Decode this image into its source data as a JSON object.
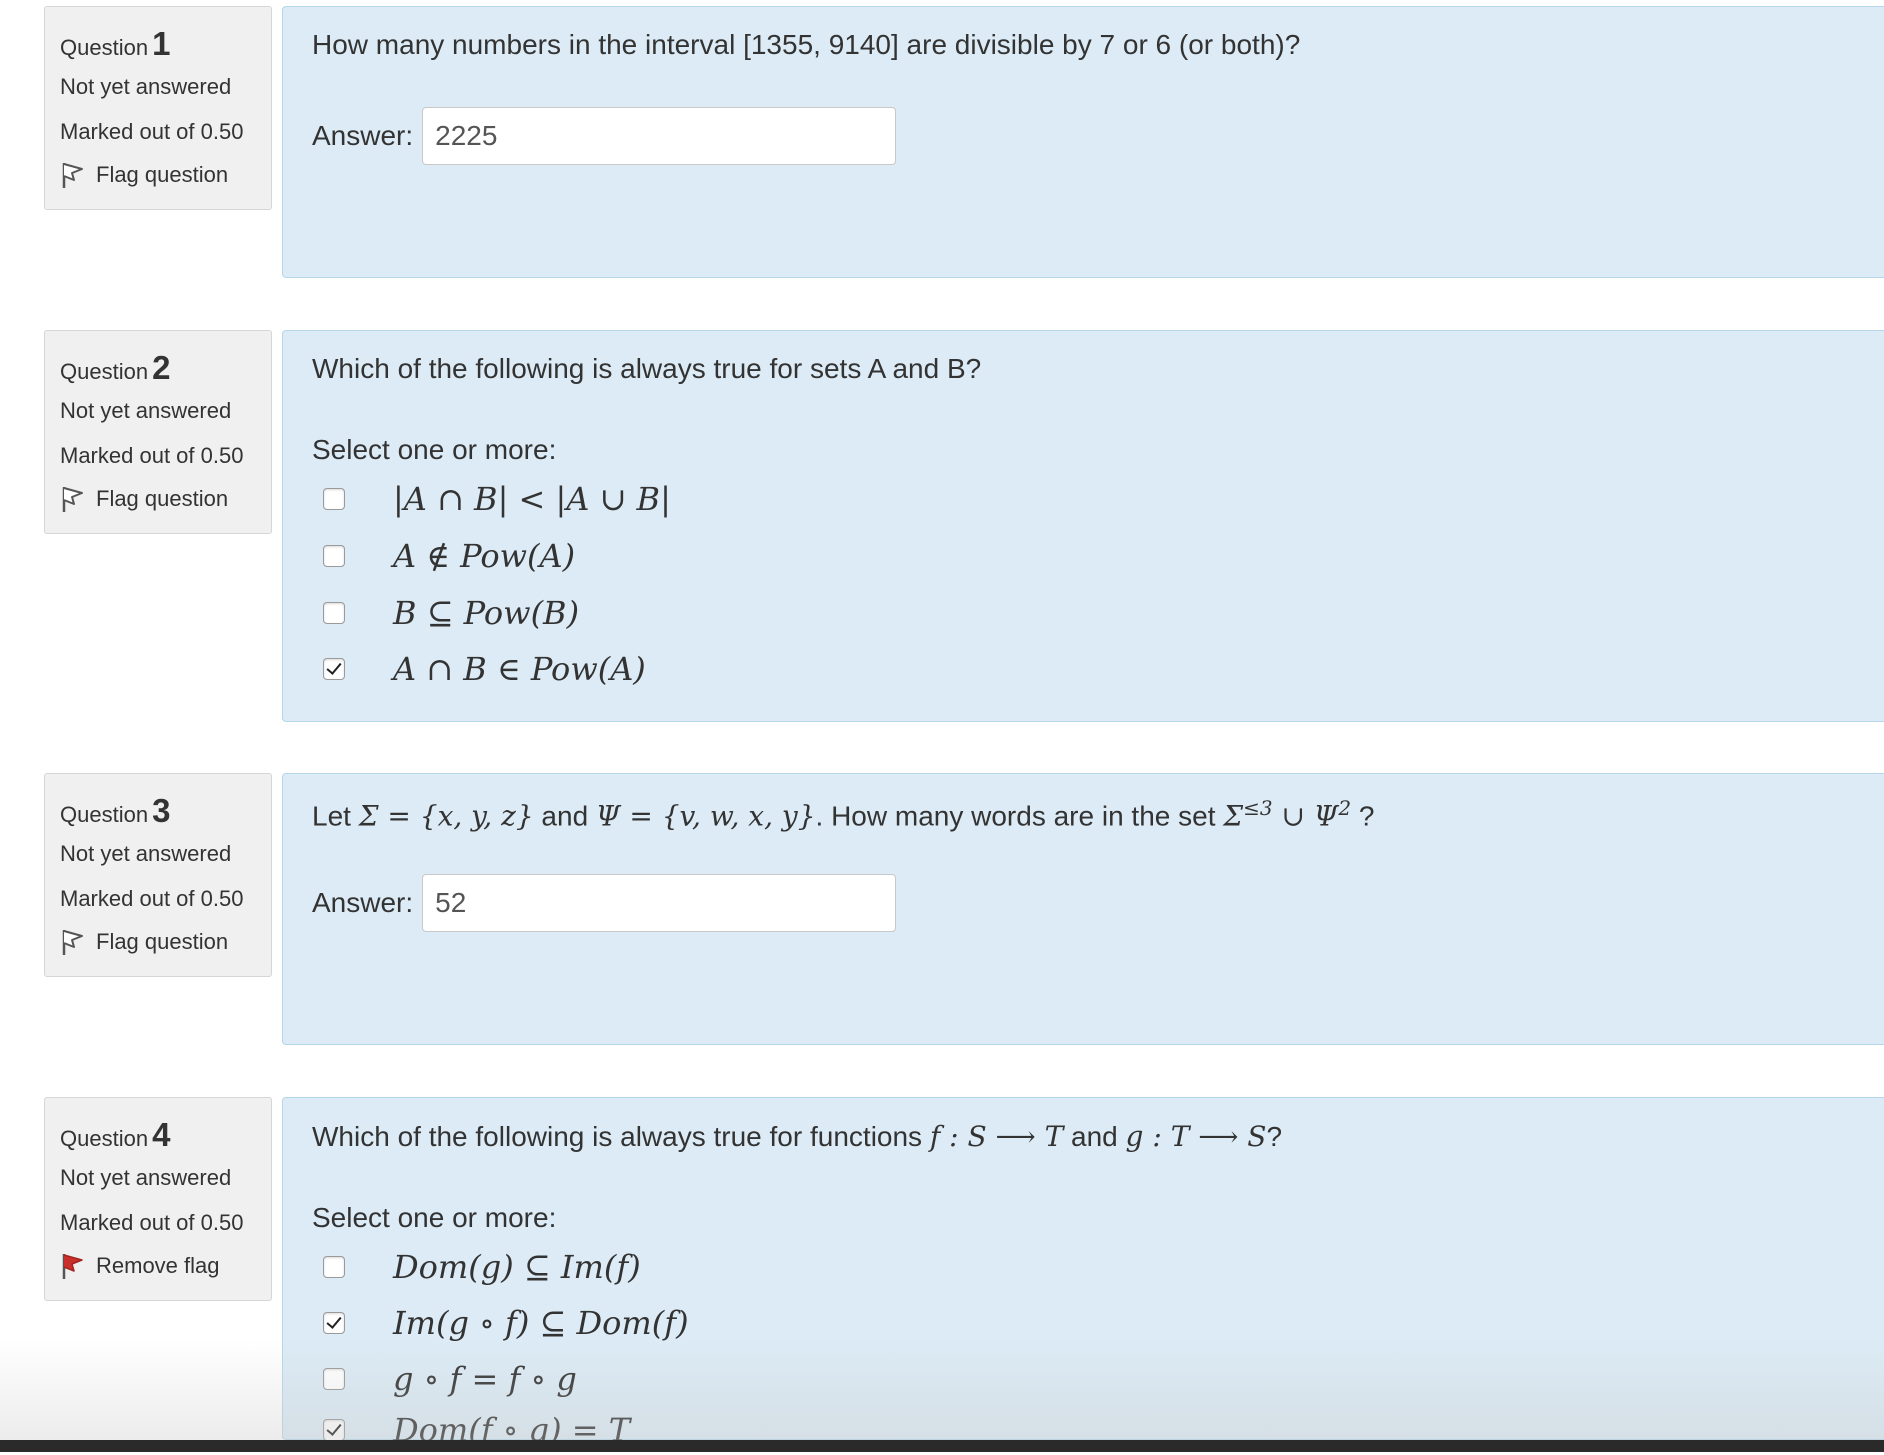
{
  "questions": [
    {
      "label": "Question",
      "number": "1",
      "state": "Not yet answered",
      "grade": "Marked out of 0.50",
      "flag_label": "Flag question",
      "flag_icon": "flag-outline-icon",
      "text": "How many numbers in the interval [1355, 9140] are divisible by 7 or 6 (or both)?",
      "answer_label": "Answer:",
      "answer_value": "2225"
    },
    {
      "label": "Question",
      "number": "2",
      "state": "Not yet answered",
      "grade": "Marked out of 0.50",
      "flag_label": "Flag question",
      "flag_icon": "flag-outline-icon",
      "text": "Which of the following is always true for sets A and B?",
      "prompt": "Select one or more:",
      "options": [
        {
          "text": "|A ∩ B| < |A ∪ B|",
          "checked": false
        },
        {
          "text": "A ∉ Pow(A)",
          "checked": false
        },
        {
          "text": "B ⊆ Pow(B)",
          "checked": false
        },
        {
          "text": "A ∩ B ∈ Pow(A)",
          "checked": true
        }
      ]
    },
    {
      "label": "Question",
      "number": "3",
      "state": "Not yet answered",
      "grade": "Marked out of 0.50",
      "flag_label": "Flag question",
      "flag_icon": "flag-outline-icon",
      "text_parts": {
        "let": "Let ",
        "sigma_def": "Σ = {x, y, z}",
        "and": " and ",
        "psi_def": "Ψ = {v, w, x, y}",
        "rest": ". How many words are in the set ",
        "set_expr": "Σ",
        "sup1": "≤3",
        "union": " ∪ Ψ",
        "sup2": "2",
        "end": " ?"
      },
      "answer_label": "Answer:",
      "answer_value": "52"
    },
    {
      "label": "Question",
      "number": "4",
      "state": "Not yet answered",
      "grade": "Marked out of 0.50",
      "flag_label": "Remove flag",
      "flag_icon": "flag-filled-red-icon",
      "text_parts": {
        "lead": "Which of the following is always true for functions ",
        "f_expr": "f : S ⟶ T",
        "and": " and ",
        "g_expr": "g : T ⟶ S",
        "end": "?"
      },
      "prompt": "Select one or more:",
      "options": [
        {
          "text": "Dom(g) ⊆ Im(f)",
          "checked": false
        },
        {
          "text": "Im(g ∘ f) ⊆ Dom(f)",
          "checked": true
        },
        {
          "text": "g ∘ f = f ∘ g",
          "checked": false
        },
        {
          "text": "Dom(f ∘ g) = T",
          "checked": true
        }
      ]
    }
  ],
  "colors": {
    "info_bg": "#f0f0f0",
    "content_bg": "#dcebf5",
    "content_border": "#b6d7ea",
    "flag_red": "#c9302c"
  }
}
